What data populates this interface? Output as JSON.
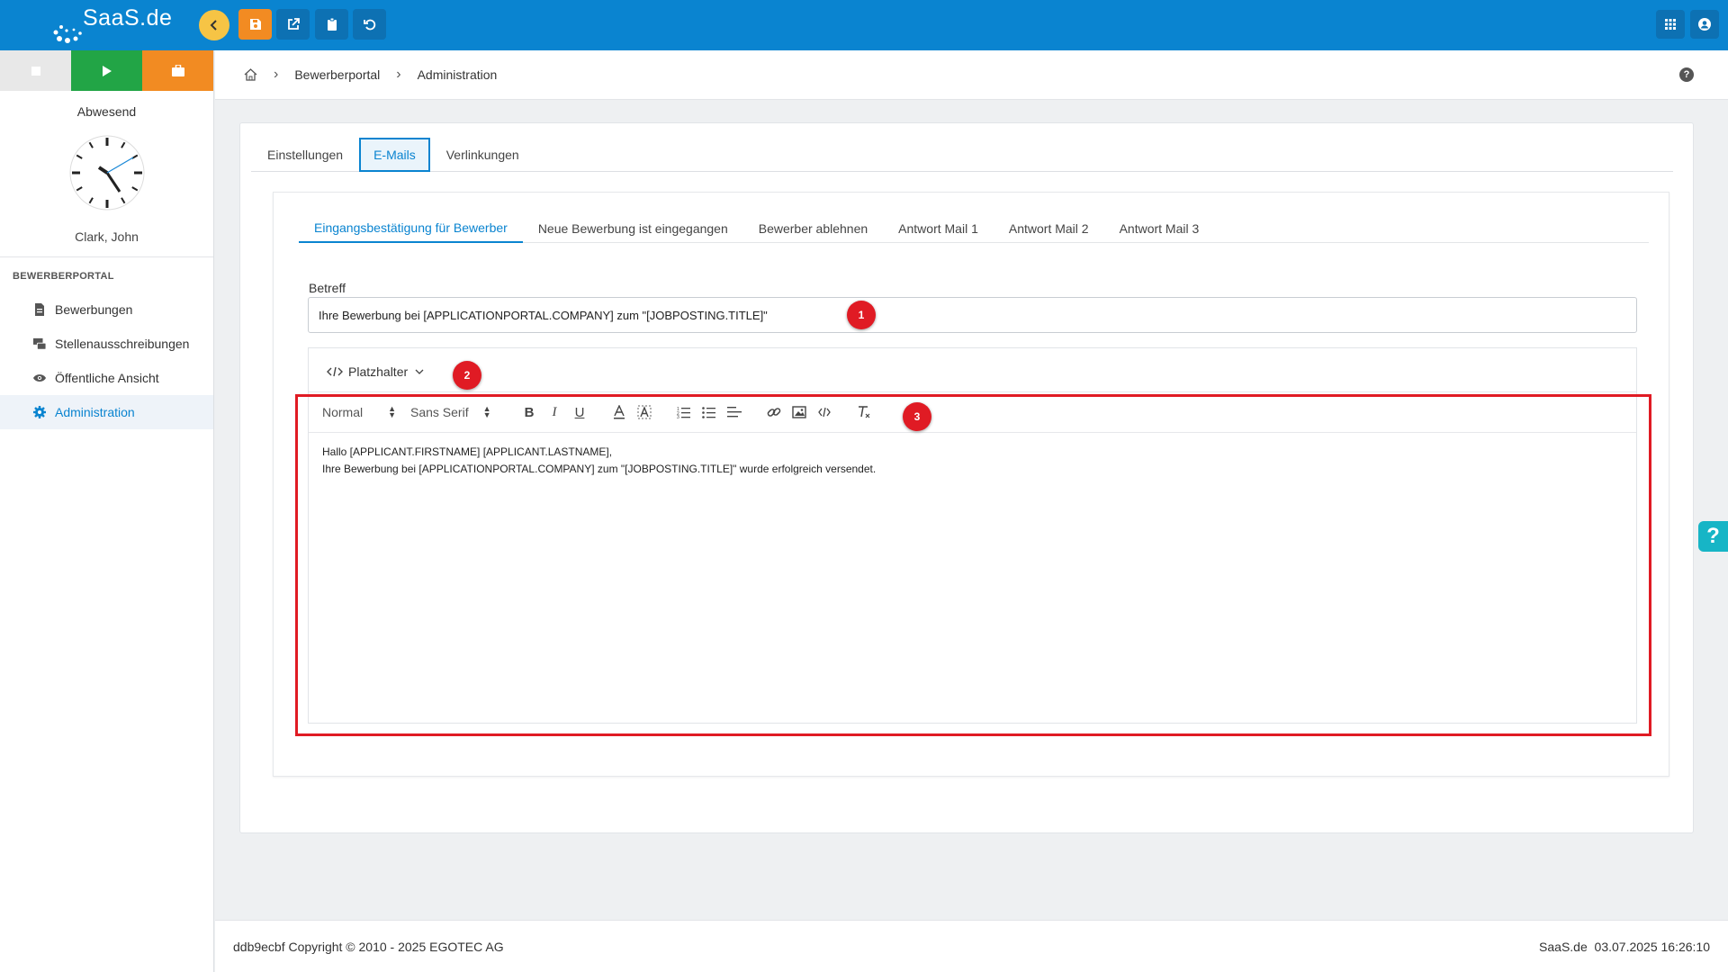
{
  "app": {
    "logo_text": "SaaS.de"
  },
  "toolbar": {
    "icons": [
      "back-icon",
      "save-icon",
      "external-link-icon",
      "clipboard-icon",
      "undo-icon"
    ],
    "right_icons": [
      "apps-grid-icon",
      "account-icon"
    ],
    "colors": {
      "bar": "#0a84d0",
      "back": "#f6c445",
      "save": "#f28b22"
    }
  },
  "sidebar": {
    "status_text": "Abwesend",
    "user_name": "Clark, John",
    "section_title": "BEWERBERPORTAL",
    "items": [
      {
        "label": "Bewerbungen",
        "icon": "document-icon"
      },
      {
        "label": "Stellenausschreibungen",
        "icon": "job-posting-icon"
      },
      {
        "label": "Öffentliche Ansicht",
        "icon": "eye-icon"
      },
      {
        "label": "Administration",
        "icon": "gear-icon",
        "active": true
      }
    ]
  },
  "breadcrumb": {
    "items": [
      "Bewerberportal",
      "Administration"
    ]
  },
  "tabs": [
    {
      "label": "Einstellungen"
    },
    {
      "label": "E-Mails",
      "active": true
    },
    {
      "label": "Verlinkungen"
    }
  ],
  "subtabs": [
    {
      "label": "Eingangsbestätigung für Bewerber",
      "active": true
    },
    {
      "label": "Neue Bewerbung ist eingegangen"
    },
    {
      "label": "Bewerber ablehnen"
    },
    {
      "label": "Antwort Mail 1"
    },
    {
      "label": "Antwort Mail 2"
    },
    {
      "label": "Antwort Mail 3"
    }
  ],
  "form": {
    "subject_label": "Betreff",
    "subject_value": "Ihre Bewerbung bei [APPLICATIONPORTAL.COMPANY] zum \"[JOBPOSTING.TITLE]\"",
    "placeholder_button": "Platzhalter",
    "editor": {
      "format_select": "Normal",
      "font_select": "Sans Serif",
      "lines": [
        "Hallo [APPLICANT.FIRSTNAME] [APPLICANT.LASTNAME],",
        "Ihre Bewerbung bei [APPLICATIONPORTAL.COMPANY] zum \"[JOBPOSTING.TITLE]\" wurde erfolgreich versendet."
      ]
    }
  },
  "markers": [
    "1",
    "2",
    "3"
  ],
  "footer": {
    "left": "ddb9ecbf Copyright © 2010 - 2025 EGOTEC AG",
    "right": "SaaS.de  03.07.2025 16:26:10"
  },
  "help_tab": "?"
}
